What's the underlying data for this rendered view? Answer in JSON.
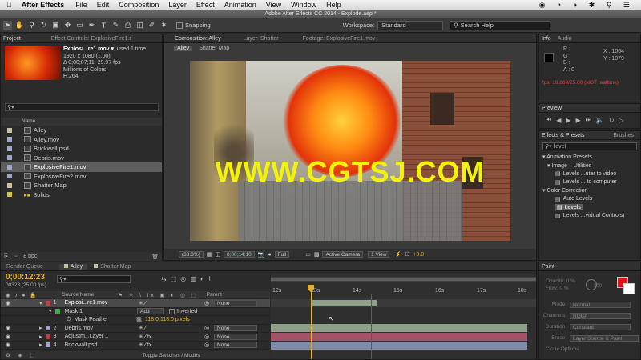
{
  "menubar": {
    "app": "After Effects",
    "items": [
      "File",
      "Edit",
      "Composition",
      "Layer",
      "Effect",
      "Animation",
      "View",
      "Window",
      "Help"
    ]
  },
  "window_title": "Adobe After Effects CC 2014 - Explode.aep *",
  "toolbar": {
    "snapping": "Snapping",
    "workspace_label": "Workspace:",
    "workspace_value": "Standard",
    "search_help": "Search Help"
  },
  "project": {
    "tab_project": "Project",
    "tab_effect_controls": "Effect Controls: ExplosiveFire1.r",
    "item_name": "Explosi...re1.mov ▾",
    "used": ", used 1 time",
    "resolution": "1920 x 1080 (1.00)",
    "duration": "Δ 0;00;07;11, 29.97 fps",
    "colors": "Millions of Colors",
    "codec": "H.264",
    "col_name": "Name",
    "items": [
      {
        "label": "Alley",
        "color": "#c8c3a0"
      },
      {
        "label": "Alley.mov",
        "color": "#a0a6c8"
      },
      {
        "label": "Brickwall.psd",
        "color": "#a0a6c8"
      },
      {
        "label": "Debris.mov",
        "color": "#a0a6c8"
      },
      {
        "label": "ExplosiveFire1.mov",
        "color": "#a0a6c8"
      },
      {
        "label": "ExplosiveFire2.mov",
        "color": "#a0a6c8"
      },
      {
        "label": "Shatter Map",
        "color": "#c8c3a0"
      },
      {
        "label": "Solids",
        "color": "#d8c040"
      }
    ],
    "bpc": "8 bpc"
  },
  "viewer": {
    "tab_comp": "Composition: Alley",
    "tab_layer": "Layer: Shatter",
    "tab_footage": "Footage: ExplosiveFire1.mov",
    "crumb1": "Alley",
    "crumb2": "Shatter Map",
    "watermark": "WWW.CGTSJ.COM",
    "zoom": "(33.3%)",
    "timecode": "0;00;14;10",
    "resolution": "Full",
    "camera": "Active Camera",
    "views": "1 View",
    "exposure": "+0.0"
  },
  "info": {
    "tab_info": "Info",
    "tab_audio": "Audio",
    "r": "R :",
    "g": "G :",
    "b": "B :",
    "a": "A : 0",
    "x": "X : 1064",
    "y": "Y : 1079",
    "fps": "fps: 19.869/25.00 (NOT realtime)"
  },
  "preview": {
    "tab": "Preview"
  },
  "effects": {
    "tab": "Effects & Presets",
    "tab_brushes": "Brushes",
    "search": "level",
    "items": [
      {
        "label": "▾ Animation Presets",
        "indent": 0
      },
      {
        "label": "▾ Image – Utilities",
        "indent": 1
      },
      {
        "label": "Levels ...uter to video",
        "indent": 2
      },
      {
        "label": "Levels ... to computer",
        "indent": 2
      },
      {
        "label": "▾ Color Correction",
        "indent": 0
      },
      {
        "label": "Auto Levels",
        "indent": 2
      },
      {
        "label": "Levels",
        "indent": 2,
        "selected": true
      },
      {
        "label": "Levels ...vidual Controls)",
        "indent": 2
      }
    ]
  },
  "timeline": {
    "tab_render": "Render Queue",
    "tab_alley": "Alley",
    "tab_shatter": "Shatter Map",
    "timecode": "0;00:12:23",
    "frames": "00323 (25.00 fps)",
    "col_source": "Source Name",
    "col_parent": "Parent",
    "layers": [
      {
        "num": "1",
        "name": "Explosi...re1.mov",
        "color": "#c04040",
        "parent": "None",
        "sel": true
      },
      {
        "num": "",
        "name": "Mask 1",
        "color": "#3fb040",
        "mode": "Add",
        "inverted": "Inverted",
        "mask": true
      },
      {
        "num": "",
        "name": "Mask Feather",
        "value": "118.0,118.0 pixels",
        "prop": true
      },
      {
        "num": "2",
        "name": "Debris.mov",
        "color": "#a0a6c8",
        "parent": "None"
      },
      {
        "num": "3",
        "name": "Adjustm...Layer 1",
        "color": "#c0c0c0",
        "parent": "None",
        "fx": true
      },
      {
        "num": "4",
        "name": "Brickwall.psd",
        "color": "#a0a6c8",
        "parent": "None",
        "fx": true
      }
    ],
    "ruler": [
      "12s",
      "13s",
      "14s",
      "15s",
      "16s",
      "17s",
      "18s"
    ],
    "toggle": "Toggle Switches / Modes"
  },
  "paint": {
    "tab": "Paint",
    "opacity": "Opacity: 0 %",
    "flow": "Flow: 0 %",
    "size": "300",
    "mode_label": "Mode:",
    "mode_value": "Normal",
    "channels_label": "Channels:",
    "channels_value": "RGBA",
    "duration_label": "Duration:",
    "duration_value": "Constant",
    "erase_label": "Erase:",
    "erase_value": "Layer Source & Paint",
    "clone": "Clone Options",
    "swatch_color": "#e8101a"
  }
}
